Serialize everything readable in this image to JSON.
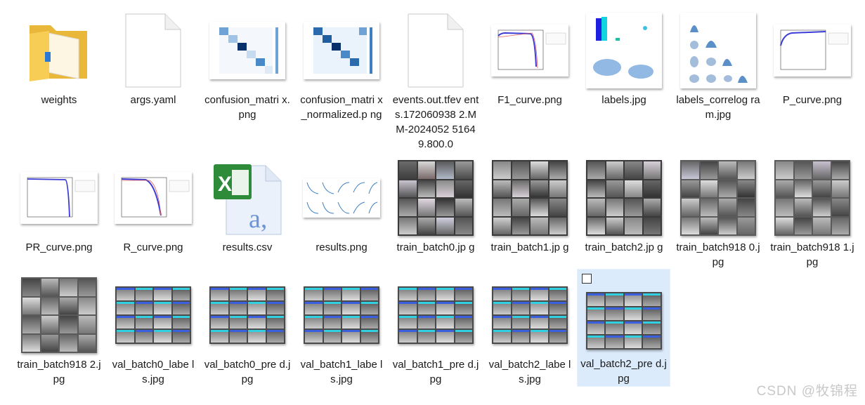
{
  "files": [
    {
      "name": "weights",
      "type": "folder"
    },
    {
      "name": "args.yaml",
      "type": "blank"
    },
    {
      "name": "confusion_matrix.png",
      "type": "confusion"
    },
    {
      "name": "confusion_matrix_normalized.png",
      "type": "confusion"
    },
    {
      "name": "events.out.tfevents.1720609382.MM-2024052 51649.800.0",
      "type": "blank"
    },
    {
      "name": "F1_curve.png",
      "type": "curve"
    },
    {
      "name": "labels.jpg",
      "type": "labels"
    },
    {
      "name": "labels_correlogram.jpg",
      "type": "correlogram"
    },
    {
      "name": "P_curve.png",
      "type": "curve"
    },
    {
      "name": "PR_curve.png",
      "type": "curve"
    },
    {
      "name": "R_curve.png",
      "type": "curve"
    },
    {
      "name": "results.csv",
      "type": "excel"
    },
    {
      "name": "results.png",
      "type": "results"
    },
    {
      "name": "train_batch0.jpg",
      "type": "photos"
    },
    {
      "name": "train_batch1.jpg",
      "type": "photos"
    },
    {
      "name": "train_batch2.jpg",
      "type": "photos"
    },
    {
      "name": "train_batch9180.jpg",
      "type": "photos_dark"
    },
    {
      "name": "train_batch9181.jpg",
      "type": "photos_dark"
    },
    {
      "name": "train_batch9182.jpg",
      "type": "photos_dark"
    },
    {
      "name": "val_batch0_labels.jpg",
      "type": "val"
    },
    {
      "name": "val_batch0_pred.jpg",
      "type": "val"
    },
    {
      "name": "val_batch1_labels.jpg",
      "type": "val"
    },
    {
      "name": "val_batch1_pred.jpg",
      "type": "val"
    },
    {
      "name": "val_batch2_labels.jpg",
      "type": "val"
    },
    {
      "name": "val_batch2_pred.jpg",
      "type": "val",
      "selected": true
    }
  ],
  "labels": {
    "weights": "weights",
    "args": "args.yaml",
    "cm": "confusion_matri x.png",
    "cmn": "confusion_matri x_normalized.p ng",
    "events": "events.out.tfev ents.172060938 2.MM-2024052 51649.800.0",
    "f1": "F1_curve.png",
    "labels": "labels.jpg",
    "corr": "labels_correlog ram.jpg",
    "p": "P_curve.png",
    "pr": "PR_curve.png",
    "r": "R_curve.png",
    "csv": "results.csv",
    "res": "results.png",
    "tb0": "train_batch0.jp g",
    "tb1": "train_batch1.jp g",
    "tb2": "train_batch2.jp g",
    "tb9180": "train_batch918 0.jpg",
    "tb9181": "train_batch918 1.jpg",
    "tb9182": "train_batch918 2.jpg",
    "v0l": "val_batch0_labe ls.jpg",
    "v0p": "val_batch0_pre d.jpg",
    "v1l": "val_batch1_labe ls.jpg",
    "v1p": "val_batch1_pre d.jpg",
    "v2l": "val_batch2_labe ls.jpg",
    "v2p": "val_batch2_pre d.jpg"
  },
  "watermark": "CSDN @牧锦程",
  "colors": {
    "selection": "#dcebfc",
    "folder": "#f5c84c",
    "matrix": "#1f5fa0",
    "curve": "#3b3bd6"
  }
}
